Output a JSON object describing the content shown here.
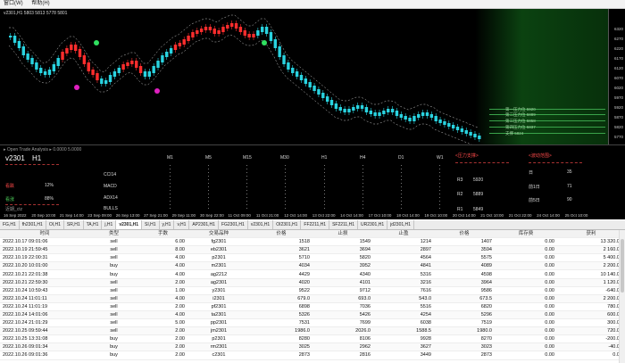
{
  "menu": {
    "items": [
      "窗口(W)",
      "帮助(H)"
    ]
  },
  "chart": {
    "title": "v2301,H1  5803 5813 5778 5801",
    "y_ticks": [
      "6320",
      "6270",
      "6220",
      "6170",
      "6120",
      "6070",
      "6020",
      "5970",
      "5920",
      "5870",
      "5820",
      "5770"
    ],
    "levels": [
      {
        "label": "第一压力位  5920"
      },
      {
        "label": "第二压力位  5889"
      },
      {
        "label": "第三压力位  5858"
      },
      {
        "label": "第四压力位  5837"
      },
      {
        "label": "支撑  5824"
      }
    ]
  },
  "chart_data": {
    "type": "candlestick",
    "title": "v2301,H1",
    "y_range": [
      5760,
      6330
    ],
    "indicator_colors": {
      "up": "#29d3e0",
      "down": "#ff2d2d",
      "bands": "#c8c8c8",
      "signal_marker": "#e020c0",
      "signal_marker_2": "#30e060",
      "zone": "#1a7a26"
    },
    "x_labels": [
      "16 Sep 2022",
      "20 Sep 10:00",
      "21 Sep 14:00",
      "23 Sep 09:00",
      "26 Sep 13:00",
      "27 Sep 21:00",
      "29 Sep 11:00",
      "30 Sep 22:00",
      "11 Oct 09:00",
      "11 Oct 21:00",
      "12 Oct 14:00",
      "13 Oct 22:00",
      "14 Oct 14:00",
      "17 Oct 10:00",
      "18 Oct 14:00",
      "19 Oct 10:00",
      "20 Oct 14:00",
      "21 Oct 10:00",
      "21 Oct 22:00",
      "24 Oct 14:00",
      "25 Oct 10:00"
    ]
  },
  "panel": {
    "header": "▸ Open Trade Analysis ▸ 0.0000 5.0000",
    "symbol": "v2301",
    "period": "H1",
    "bear_label": "看跌",
    "bear_value": "12%",
    "bull_label": "看涨",
    "bull_value": "88%",
    "indicators": [
      "CCI14",
      "MACD",
      "ADX14",
      "BULLS"
    ],
    "timeframes": [
      "M1",
      "M5",
      "M15",
      "M30",
      "H1",
      "H4",
      "D1",
      "W1"
    ],
    "pressure_title": "<压力支撑>",
    "pressure_rows": [
      {
        "label": "R3",
        "value": "5920"
      },
      {
        "label": "R2",
        "value": "5889"
      },
      {
        "label": "R1",
        "value": "5849"
      }
    ],
    "range_title": "<波动范围>",
    "range_rows": [
      {
        "label": "日",
        "value": "35"
      },
      {
        "label": "前1日",
        "value": "71"
      },
      {
        "label": "前5日",
        "value": "90"
      }
    ],
    "footer": "近期_ctz"
  },
  "tabs": [
    "FG,H1",
    "fh2301,H1",
    "OI,H1",
    "SR,H1",
    "TA,H1",
    "j,H1",
    "v2301,H1",
    "SI,H1",
    "y,H1",
    "v,H1",
    "AP2301,H1",
    "FG2301,H1",
    "v2301,H1",
    "OI2301,H1",
    "FF2211,H1",
    "SF2211,H1",
    "UR2301,H1",
    "jd2301,H1"
  ],
  "active_tab": 6,
  "table": {
    "headers": [
      "时间",
      "类型",
      "手数",
      "交易品种",
      "价格",
      "止损",
      "止盈",
      "价格",
      "库存费",
      "获利"
    ],
    "rows": [
      [
        "2022.10.17 09:01:06",
        "sell",
        "6.00",
        "fg2301",
        "1518",
        "1549",
        "1214",
        "1407",
        "0.00",
        "13 320.00"
      ],
      [
        "2022.10.19 21:59:45",
        "sell",
        "8.00",
        "eb2301",
        "3621",
        "3694",
        "2897",
        "3594",
        "0.00",
        "2 160.00"
      ],
      [
        "2022.10.19 22:00:31",
        "sell",
        "4.00",
        "p2301",
        "5710",
        "5820",
        "4564",
        "5575",
        "0.00",
        "5 400.00"
      ],
      [
        "2022.10.20 10:01:00",
        "buy",
        "4.00",
        "m2301",
        "4034",
        "3952",
        "4841",
        "4089",
        "0.00",
        "2 200.00"
      ],
      [
        "2022.10.21 22:01:38",
        "buy",
        "4.00",
        "ag2212",
        "4429",
        "4340",
        "5316",
        "4598",
        "0.00",
        "10 140.00"
      ],
      [
        "2022.10.21 22:59:30",
        "sell",
        "2.00",
        "ag2301",
        "4020",
        "4101",
        "3216",
        "3964",
        "0.00",
        "1 120.00"
      ],
      [
        "2022.10.24 10:59:43",
        "sell",
        "1.00",
        "y2301",
        "9522",
        "9712",
        "7616",
        "9586",
        "0.00",
        "-640.00"
      ],
      [
        "2022.10.24 11:01:11",
        "sell",
        "4.00",
        "i2301",
        "679.0",
        "693.0",
        "543.0",
        "673.5",
        "0.00",
        "2 200.00"
      ],
      [
        "2022.10.24 11:01:19",
        "sell",
        "2.00",
        "pf2301",
        "6898",
        "7036",
        "5516",
        "6820",
        "0.00",
        "780.00"
      ],
      [
        "2022.10.24 14:01:06",
        "sell",
        "4.00",
        "ta2301",
        "5326",
        "5426",
        "4254",
        "5296",
        "0.00",
        "600.00"
      ],
      [
        "2022.10.24 21:01:29",
        "sell",
        "5.00",
        "pp2301",
        "7531",
        "7699",
        "6038",
        "7519",
        "0.00",
        "300.00"
      ],
      [
        "2022.10.25 09:59:44",
        "sell",
        "2.00",
        "jm2301",
        "1986.0",
        "2026.0",
        "1588.5",
        "1980.0",
        "0.00",
        "720.00"
      ],
      [
        "2022.10.25 13:31:08",
        "buy",
        "2.00",
        "p2301",
        "8280",
        "8106",
        "9928",
        "8270",
        "0.00",
        "-200.00"
      ],
      [
        "2022.10.26 09:01:34",
        "buy",
        "2.00",
        "rm2301",
        "3025",
        "2962",
        "3627",
        "3023",
        "0.00",
        "-40.00"
      ],
      [
        "2022.10.26 09:01:36",
        "buy",
        "2.00",
        "c2301",
        "2873",
        "2816",
        "3449",
        "2873",
        "0.00",
        "0.00"
      ]
    ]
  }
}
